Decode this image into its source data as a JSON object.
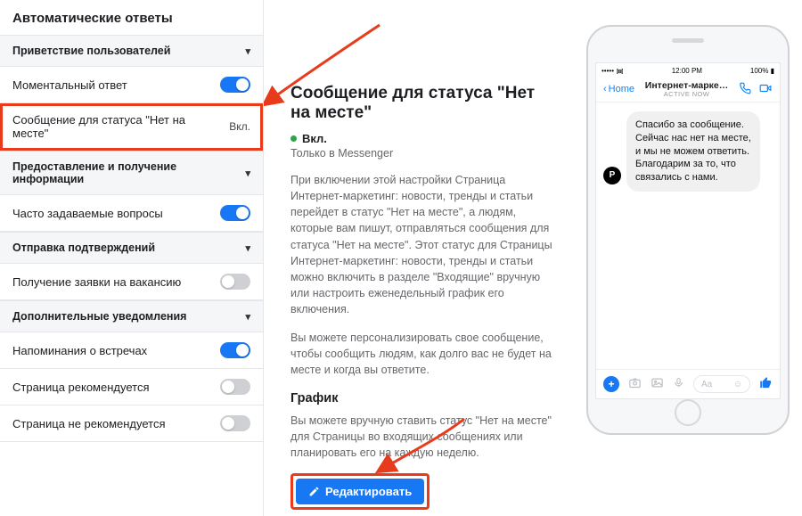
{
  "sidebar": {
    "title": "Автоматические ответы",
    "groups": {
      "greet": "Приветствие пользователей",
      "info": "Предоставление и получение информации",
      "confirm": "Отправка подтверждений",
      "extra": "Дополнительные уведомления"
    },
    "items": {
      "instant": "Моментальный ответ",
      "away": "Сообщение для статуса \"Нет на месте\"",
      "away_status": "Вкл.",
      "faq": "Часто задаваемые вопросы",
      "vacancy": "Получение заявки на вакансию",
      "remind": "Напоминания о встречах",
      "recommend": "Страница рекомендуется",
      "not_recommend": "Страница не рекомендуется"
    }
  },
  "main": {
    "heading": "Сообщение для статуса \"Нет на месте\"",
    "status": "Вкл.",
    "subtitle": "Только в Messenger",
    "para1": "При включении этой настройки Страница Интернет-маркетинг: новости, тренды и статьи перейдет в статус \"Нет на месте\", а людям, которые вам пишут, отправляться сообщения для статуса \"Нет на месте\". Этот статус для Страницы Интернет-маркетинг: новости, тренды и статьи можно включить в разделе \"Входящие\" вручную или настроить еженедельный график его включения.",
    "para2": "Вы можете персонализировать свое сообщение, чтобы сообщить людям, как долго вас не будет на месте и когда вы ответите.",
    "schedule_h": "График",
    "para3": "Вы можете вручную ставить статус \"Нет на месте\" для Страницы во входящих сообщениях или планировать его на каждую неделю.",
    "edit_btn": "Редактировать"
  },
  "phone": {
    "carrier": "●●●●●",
    "wifi": "᯾",
    "time": "12:00 PM",
    "battery": "100%",
    "home": "Home",
    "chat_name": "Интернет-марке…",
    "active": "active now",
    "message": "Спасибо за сообщение. Сейчас нас нет на месте, и мы не можем ответить. Благодарим за то, что связались с нами.",
    "placeholder": "Aa"
  }
}
